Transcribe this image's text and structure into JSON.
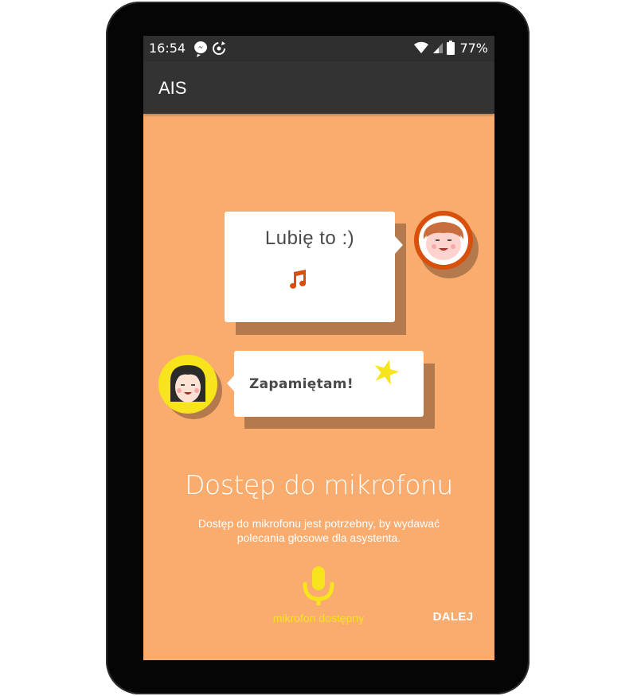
{
  "status_bar": {
    "time": "16:54",
    "battery": "77%",
    "left_icons": [
      "messenger-icon",
      "sync-icon"
    ],
    "right_icons": [
      "wifi-icon",
      "signal-icon",
      "battery-icon"
    ]
  },
  "app_bar": {
    "title": "AIS"
  },
  "illustration": {
    "user_message": "Lubię to :)",
    "user_message_icon": "music-note-icon",
    "assistant_message": "Zapamiętam!",
    "assistant_message_icon": "star-icon",
    "user_avatar": "boy-avatar",
    "assistant_avatar": "girl-avatar"
  },
  "main": {
    "heading": "Dostęp do mikrofonu",
    "description": "Dostęp do mikrofonu jest potrzebny, by wydawać polecania głosowe dla asystenta.",
    "mic_icon": "microphone-icon",
    "mic_status": "mikrofon dostępny",
    "next_label": "DALEJ"
  },
  "colors": {
    "background": "#f9ac6e",
    "app_bar": "#333333",
    "accent_yellow": "#f7e41c",
    "avatar_orange": "#d94f0c"
  }
}
